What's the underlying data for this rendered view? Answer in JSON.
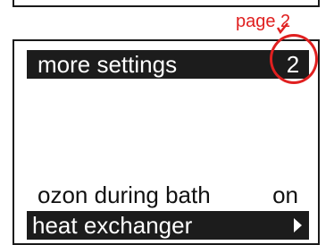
{
  "annotation": {
    "label": "page 2",
    "color": "#e02020"
  },
  "screen": {
    "header": {
      "title": "more settings",
      "page_number": "2"
    },
    "items": [
      {
        "label": "ozon during bath",
        "value": "on",
        "selected": false
      },
      {
        "label": "heat exchanger",
        "icon": "right-arrow-icon",
        "selected": true
      }
    ]
  },
  "colors": {
    "display_text": "#111111",
    "highlight_bg": "#1c1c1c",
    "highlight_text": "#ffffff"
  }
}
